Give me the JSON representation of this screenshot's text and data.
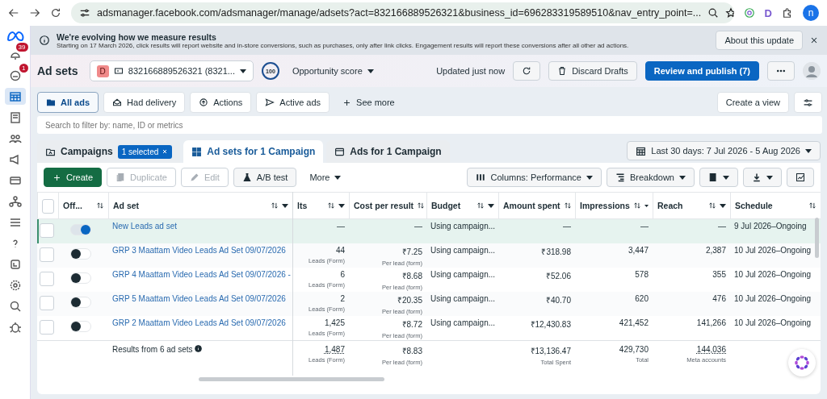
{
  "browser": {
    "url": "adsmanager.facebook.com/adsmanager/manage/adsets?act=832166889526321&business_id=696283319589510&nav_entry_point=...",
    "profile_letter": "D",
    "avatar_letter": "n"
  },
  "sidebar": {
    "items": [
      {
        "selected": false,
        "badge": "39"
      },
      {
        "selected": false,
        "badge": "1"
      },
      {
        "selected": true
      },
      {
        "selected": false
      },
      {
        "selected": false
      },
      {
        "selected": false
      },
      {
        "selected": false
      },
      {
        "selected": false
      },
      {
        "selected": false
      },
      {
        "selected": false
      },
      {
        "selected": false
      },
      {
        "selected": false
      },
      {
        "selected": false
      },
      {
        "selected": false
      }
    ]
  },
  "banner": {
    "title": "We're evolving how we measure results",
    "text": "Starting on 17 March 2026, click results will report website and in-store conversions, such as purchases, only after link clicks. Engagement results will report these conversions after all other ad actions.",
    "button": "About this update"
  },
  "header": {
    "title": "Ad sets",
    "account_badge": "D",
    "account": "832166889526321 (8321...",
    "score": "100",
    "score_label": "Opportunity score",
    "updated": "Updated just now",
    "discard": "Discard Drafts",
    "publish": "Review and publish (7)"
  },
  "filters": {
    "chips": [
      {
        "label": "All ads",
        "selected": true
      },
      {
        "label": "Had delivery",
        "selected": false
      },
      {
        "label": "Actions",
        "selected": false
      },
      {
        "label": "Active ads",
        "selected": false
      }
    ],
    "see_more": "See more",
    "create_view": "Create a view"
  },
  "search": {
    "placeholder": "Search to filter by: name, ID or metrics"
  },
  "tabs": [
    {
      "label": "Campaigns",
      "selected": false,
      "badge": "1 selected"
    },
    {
      "label": "Ad sets for 1 Campaign",
      "selected": true
    },
    {
      "label": "Ads for 1 Campaign",
      "selected": false
    }
  ],
  "date_range": "Last 30 days: 7 Jul 2026 - 5 Aug 2026",
  "toolbar": {
    "buttons": [
      {
        "kind": "primary",
        "label": "Create",
        "disabled": false
      },
      {
        "kind": "duplicate",
        "label": "Duplicate",
        "disabled": true
      },
      {
        "kind": "edit",
        "label": "Edit",
        "disabled": true
      },
      {
        "kind": "abtest",
        "label": "A/B test",
        "disabled": false
      },
      {
        "kind": "menu",
        "label": "More",
        "disabled": false
      }
    ],
    "columns": "Columns: Performance",
    "breakdown": "Breakdown"
  },
  "table": {
    "select_all_checked": false,
    "columns": [
      "Off...",
      "Ad set",
      "lts",
      "Cost per result",
      "Budget",
      "Amount spent",
      "Impressions",
      "Reach",
      "Schedule"
    ],
    "rows": [
      {
        "selected": true,
        "checked": false,
        "on": true,
        "name": "New Leads ad set",
        "results": "—",
        "cost": "—",
        "budget": "Using campaign...",
        "amount": "—",
        "impressions": "—",
        "reach": "—",
        "schedule": "9 Jul 2026–Ongoing"
      },
      {
        "selected": false,
        "checked": false,
        "on": false,
        "name": "GRP 3 Maattam Video Leads Ad Set 09/07/2026",
        "results": "44",
        "results_sub": "Leads (Form)",
        "cost": "₹7.25",
        "cost_sub": "Per lead (form)",
        "budget": "Using campaign...",
        "amount": "₹318.98",
        "impressions": "3,447",
        "reach": "2,387",
        "schedule": "10 Jul 2026–Ongoing"
      },
      {
        "selected": false,
        "checked": false,
        "on": false,
        "name": "GRP 4 Maattam Video Leads Ad Set 09/07/2026 -",
        "results": "6",
        "results_sub": "Leads (Form)",
        "cost": "₹8.68",
        "cost_sub": "Per lead (form)",
        "budget": "Using campaign...",
        "amount": "₹52.06",
        "impressions": "578",
        "reach": "355",
        "schedule": "10 Jul 2026–Ongoing"
      },
      {
        "selected": false,
        "checked": false,
        "on": false,
        "name": "GRP 5 Maattam Video Leads Ad Set 09/07/2026",
        "results": "2",
        "results_sub": "Leads (Form)",
        "cost": "₹20.35",
        "cost_sub": "Per lead (form)",
        "budget": "Using campaign...",
        "amount": "₹40.70",
        "impressions": "620",
        "reach": "476",
        "schedule": "10 Jul 2026–Ongoing"
      },
      {
        "selected": false,
        "checked": false,
        "on": false,
        "name": "GRP 2 Maattam Video Leads Ad Set 09/07/2026",
        "results": "1,425",
        "results_sub": "Leads (Form)",
        "cost": "₹8.72",
        "cost_sub": "Per lead (form)",
        "budget": "Using campaign...",
        "amount": "₹12,430.83",
        "impressions": "421,452",
        "reach": "141,266",
        "schedule": "10 Jul 2026–Ongoing"
      }
    ],
    "footer": {
      "label": "Results from 6 ad sets",
      "results": "1,487",
      "results_sub": "Leads (Form)",
      "cost": "₹8.83",
      "cost_sub": "Per lead (form)",
      "amount": "₹13,136.47",
      "amount_sub": "Total Spent",
      "impressions": "429,730",
      "impressions_sub": "Total",
      "reach": "144,036",
      "reach_sub": "Meta accounts"
    }
  }
}
